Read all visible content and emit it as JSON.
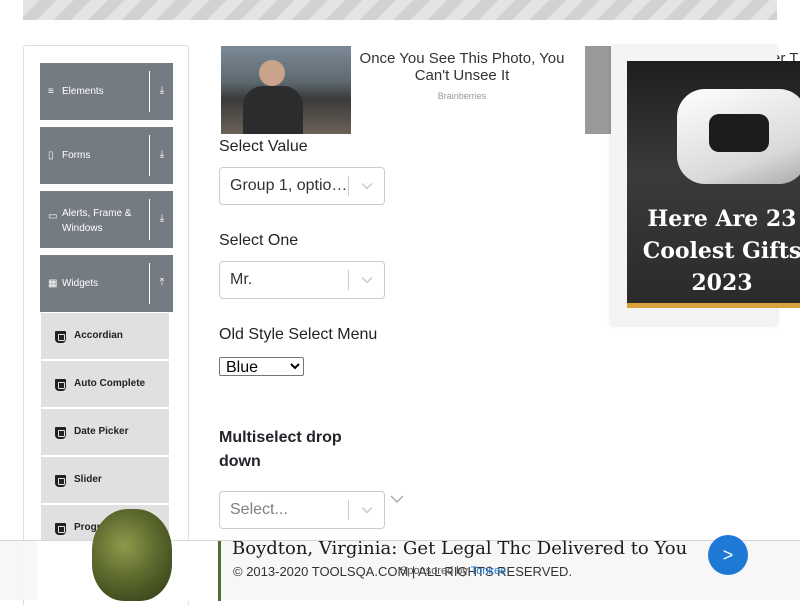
{
  "sidebar": {
    "groups": [
      {
        "label": "Elements",
        "icon": "hamburger-icon",
        "arrow": "download-arrow-icon"
      },
      {
        "label": "Forms",
        "icon": "document-icon",
        "arrow": "download-arrow-icon"
      },
      {
        "label": "Alerts, Frame & Windows",
        "icon": "window-icon",
        "arrow": "download-arrow-icon"
      },
      {
        "label": "Widgets",
        "icon": "grid-icon",
        "arrow": "upload-arrow-icon"
      }
    ],
    "widget_items": [
      "Accordian",
      "Auto Complete",
      "Date Picker",
      "Slider",
      "Progress Bar"
    ]
  },
  "ad_top": {
    "title": "Once You See This Photo, You Can't Unsee It",
    "source": "Brainberries",
    "cut_text": "er T"
  },
  "form": {
    "select_value": {
      "label": "Select Value",
      "value": "Group 1, option 1"
    },
    "select_one": {
      "label": "Select One",
      "value": "Mr."
    },
    "old_style": {
      "label": "Old Style Select Menu",
      "value": "Blue",
      "options": [
        "Blue"
      ]
    },
    "multiselect": {
      "label": "Multiselect drop down",
      "placeholder": "Select..."
    }
  },
  "video_ad": {
    "caption": "Here Are 23 Coolest Gifts 2023"
  },
  "bottom_ad": {
    "headline": "Boydton, Virginia: Get Legal Thc Delivered to You",
    "cta": ">",
    "sponsored_prefix": "Sponsored by ",
    "sponsored_brand": "Tonkee"
  },
  "footer": {
    "text": "© 2013-2020 TOOLSQA.COM | ALL RIGHTS RESERVED."
  },
  "colors": {
    "sidebar_group_bg": "#757b82",
    "sidebar_item_bg": "#e0e0e0",
    "cta_blue": "#1e78d6"
  }
}
